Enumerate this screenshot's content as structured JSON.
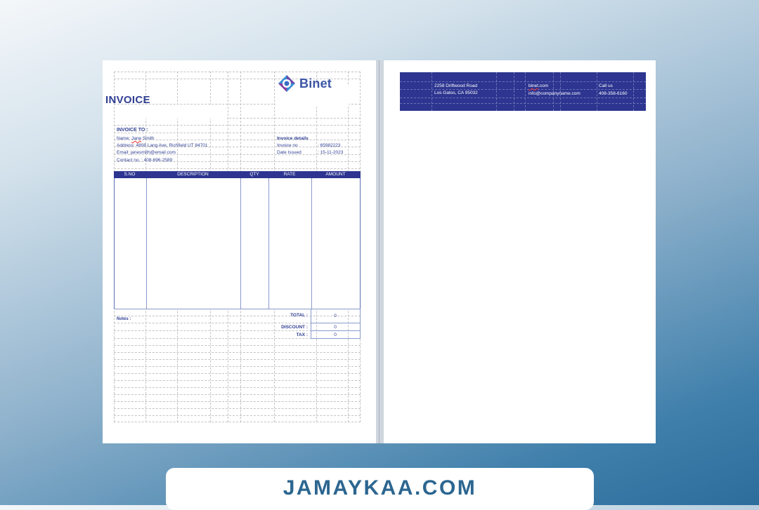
{
  "invoice": {
    "logo_text": "Binet",
    "title": "INVOICE",
    "bill_to_heading": "INVOICE TO :",
    "name_prefix": "Name:",
    "name_first": "Jane",
    "name_last": "Smith",
    "address": "Address: 4808 Lang Ave, Richfield UT 84701",
    "email": "Email: janesmith@email.com",
    "contact": "Contact no. : 408-696-2589",
    "details_heading": "Invoice details",
    "invoice_no_label": "Invoice no",
    "invoice_no_value": ": 65982223",
    "date_label": "Date Issued",
    "date_value": ": 15-11-2023",
    "columns": [
      "S.NO",
      "DESCRIPTION",
      "QTY",
      "RATE",
      "AMOUNT"
    ],
    "notes_label": "Notes :",
    "total_label": "TOTAL :",
    "total_value": "0",
    "discount_label": "DISCOUNT :",
    "discount_value": "0",
    "tax_label": "TAX :",
    "tax_value": "0"
  },
  "footer_band": {
    "street": "2258 Driftwood Road",
    "city": "Los Gatos, CA 95032",
    "web_word": "binet",
    "web_rest": ".com",
    "email": "info@companyname.com",
    "call_label": "Call us",
    "phone": "408-358-6160"
  },
  "banner": {
    "text": "JAMAYKAA.COM"
  },
  "colors": {
    "accent": "#2d3590",
    "text_blue": "#2f3e92",
    "banner_text": "#2c6690"
  }
}
